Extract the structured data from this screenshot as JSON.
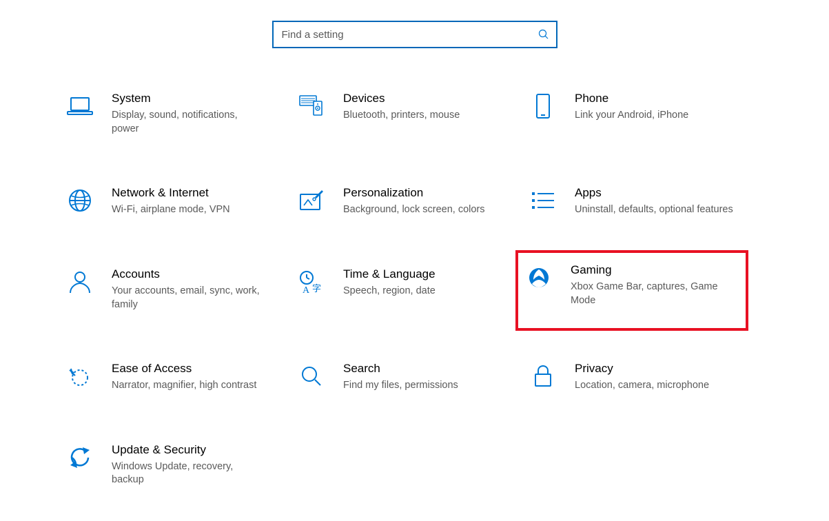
{
  "search": {
    "placeholder": "Find a setting"
  },
  "colors": {
    "accent": "#0078d4",
    "border_highlight": "#e81123",
    "text_muted": "#5a5a5a"
  },
  "categories": {
    "system": {
      "title": "System",
      "desc": "Display, sound, notifications, power"
    },
    "devices": {
      "title": "Devices",
      "desc": "Bluetooth, printers, mouse"
    },
    "phone": {
      "title": "Phone",
      "desc": "Link your Android, iPhone"
    },
    "network": {
      "title": "Network & Internet",
      "desc": "Wi-Fi, airplane mode, VPN"
    },
    "personalization": {
      "title": "Personalization",
      "desc": "Background, lock screen, colors"
    },
    "apps": {
      "title": "Apps",
      "desc": "Uninstall, defaults, optional features"
    },
    "accounts": {
      "title": "Accounts",
      "desc": "Your accounts, email, sync, work, family"
    },
    "time_language": {
      "title": "Time & Language",
      "desc": "Speech, region, date"
    },
    "gaming": {
      "title": "Gaming",
      "desc": "Xbox Game Bar, captures, Game Mode"
    },
    "ease_of_access": {
      "title": "Ease of Access",
      "desc": "Narrator, magnifier, high contrast"
    },
    "search": {
      "title": "Search",
      "desc": "Find my files, permissions"
    },
    "privacy": {
      "title": "Privacy",
      "desc": "Location, camera, microphone"
    },
    "update_security": {
      "title": "Update & Security",
      "desc": "Windows Update, recovery, backup"
    }
  },
  "highlighted_category": "gaming"
}
